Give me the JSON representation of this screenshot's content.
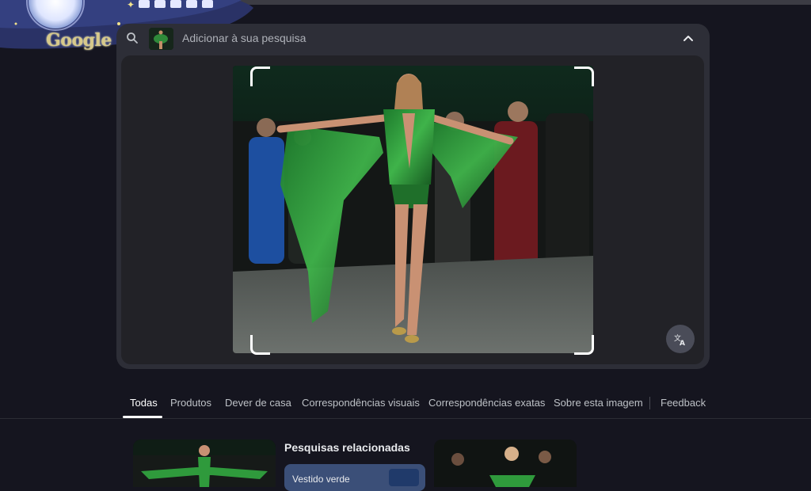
{
  "brand": {
    "logo_text": "Google"
  },
  "search": {
    "placeholder": "Adicionar à sua pesquisa",
    "search_icon": "search-icon",
    "collapse_icon": "chevron-up-icon",
    "translate_icon": "translate-icon"
  },
  "tabs": [
    {
      "label": "Todas",
      "active": true
    },
    {
      "label": "Produtos",
      "active": false
    },
    {
      "label": "Dever de casa",
      "active": false
    },
    {
      "label": "Correspondências visuais",
      "active": false
    },
    {
      "label": "Correspondências exatas",
      "active": false
    },
    {
      "label": "Sobre esta imagem",
      "active": false
    },
    {
      "label": "Feedback",
      "active": false
    }
  ],
  "results": {
    "related_title": "Pesquisas relacionadas",
    "related_chip_label": "Vestido verde"
  },
  "colors": {
    "background": "#15151f",
    "panel": "#2d2e37",
    "accent_active_tab": "#ffffff"
  }
}
